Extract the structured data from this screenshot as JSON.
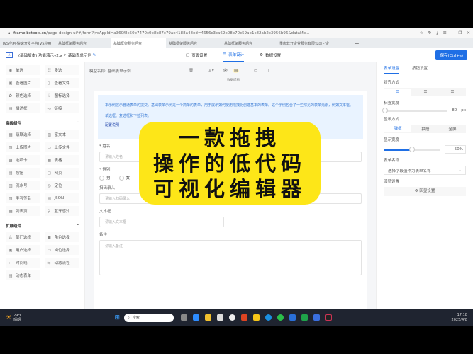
{
  "browser": {
    "url_host": "frame.bctools.cn",
    "url_path": "/page-design-ui/#/form?jvsAppId=a360f8c50e7470c0e8b87c79ae4188a48ed=4656c3ca62e08e70c59ae1c82ab2c3956b96&dataMo...",
    "tabs": [
      "JVS应用-快速开发平台(V5应用)",
      "基础框架服务后台",
      "基础框架服务后台",
      "基础框架服务后台",
      "基础框架服务后台",
      "重庆软开企业服务有限公司 - 企"
    ]
  },
  "app": {
    "logo": "A",
    "breadcrumb": "(基础版本) 功能演示v2.x",
    "breadcrumb_sep": ">",
    "page": "基础表单示例",
    "nav": [
      {
        "label": "页面设置",
        "icon": "▢"
      },
      {
        "label": "表单设计",
        "icon": "☰"
      },
      {
        "label": "数据设置",
        "icon": "⚙"
      }
    ],
    "save": "保存(Ctrl+s)"
  },
  "sidebar": {
    "basic": [
      {
        "icon": "◉",
        "label": "单选"
      },
      {
        "icon": "☷",
        "label": "多选"
      },
      {
        "icon": "▣",
        "label": "查看图片"
      },
      {
        "icon": "▯",
        "label": "查看文件"
      },
      {
        "icon": "✿",
        "label": "颜色选择"
      },
      {
        "icon": "♧",
        "label": "图标选择"
      },
      {
        "icon": "▤",
        "label": "描述框"
      },
      {
        "icon": "↝",
        "label": "链接"
      }
    ],
    "advanced_title": "高级组件",
    "advanced": [
      {
        "icon": "▦",
        "label": "级联选择"
      },
      {
        "icon": "▧",
        "label": "富文本"
      },
      {
        "icon": "▨",
        "label": "上传图片"
      },
      {
        "icon": "▭",
        "label": "上传文件"
      },
      {
        "icon": "▩",
        "label": "选项卡"
      },
      {
        "icon": "▦",
        "label": "表格"
      },
      {
        "icon": "▤",
        "label": "按钮"
      },
      {
        "icon": "▢",
        "label": "网页"
      },
      {
        "icon": "▥",
        "label": "流水号"
      },
      {
        "icon": "◎",
        "label": "定位"
      },
      {
        "icon": "▧",
        "label": "手写签名"
      },
      {
        "icon": "▤",
        "label": "JSON"
      },
      {
        "icon": "▦",
        "label": "列表页"
      },
      {
        "icon": "⚲",
        "label": "蓝牙感知"
      }
    ],
    "ext_title": "扩展组件",
    "ext": [
      {
        "icon": "♙",
        "label": "部门选择"
      },
      {
        "icon": "▣",
        "label": "角色选择"
      },
      {
        "icon": "▣",
        "label": "用户选择"
      },
      {
        "icon": "▭",
        "label": "岗位选择"
      },
      {
        "icon": "▸",
        "label": "时间线"
      },
      {
        "icon": "⇆",
        "label": "动态流程"
      },
      {
        "icon": "▤",
        "label": "动态表单"
      }
    ]
  },
  "canvas": {
    "model_label": "模型名称: 基础表单示例",
    "tooltip": "数据结构",
    "info": "本示例展示普通表单的提交。基础表单示例是一个简单的表单，用于展示如何使用拖拽化创建基本的表单。这个示例包含了一些常见的表单元素，例如文本框、单选框、复选框和下拉列表。",
    "info_link": "配置说明",
    "fields": {
      "name_label": "* 姓名",
      "name_ph": "请输入姓名",
      "gender_label": "* 性别",
      "male": "男",
      "female": "女",
      "scan_label": "扫码录入",
      "scan_ph": "请输入扫码录入",
      "text_label": "文本框",
      "text_ph": "请输入文本框",
      "note_label": "备注",
      "note_ph": "请输入备注"
    }
  },
  "overlay": {
    "lines": [
      "一款拖拽",
      "操作的低代码",
      "可视化编辑器"
    ]
  },
  "rpanel": {
    "tabs": [
      "表单设置",
      "按钮设置"
    ],
    "align_label": "对齐方式",
    "label_width_label": "标签宽度",
    "label_width": "80",
    "unit": "px",
    "display_label": "显示方式",
    "display_opts": [
      "弹框",
      "抽屉",
      "全屏"
    ],
    "show_width_label": "显示宽度",
    "show_width": "50%",
    "show_width_value": 50,
    "form_name_label": "表单名称",
    "form_name_ph": "选择字段值作为表单名称",
    "rule_label": "回显设置",
    "rule_btn": "回显设置"
  },
  "taskbar": {
    "temp": "29°C",
    "weather": "晴朗",
    "search": "搜索",
    "time": "17:18",
    "date": "2025/4/8"
  }
}
